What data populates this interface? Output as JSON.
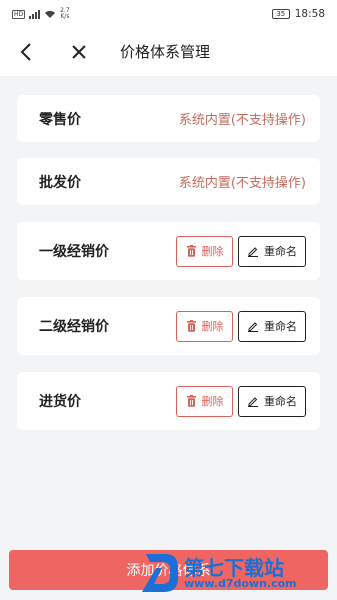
{
  "status_bar": {
    "network_badge": "HD",
    "speed_value": "2.7",
    "speed_unit": "K/s",
    "battery": "35",
    "time": "18:58"
  },
  "nav": {
    "title": "价格体系管理",
    "back_icon": "back-arrow-icon",
    "close_icon": "close-icon"
  },
  "builtin_items": [
    {
      "name": "零售价",
      "note": "系统内置(不支持操作)"
    },
    {
      "name": "批发价",
      "note": "系统内置(不支持操作)"
    }
  ],
  "custom_items": [
    {
      "name": "一级经销价",
      "delete_label": "删除",
      "rename_label": "重命名"
    },
    {
      "name": "二级经销价",
      "delete_label": "删除",
      "rename_label": "重命名"
    },
    {
      "name": "进货价",
      "delete_label": "删除",
      "rename_label": "重命名"
    }
  ],
  "footer": {
    "add_label": "添加价格体系"
  },
  "watermark": {
    "brand": "第七下载站",
    "url": "www.d7down.com"
  },
  "colors": {
    "accent": "#ef6561",
    "note": "#c56b5e",
    "delete": "#d9625a",
    "watermark": "#1c6fd6"
  }
}
